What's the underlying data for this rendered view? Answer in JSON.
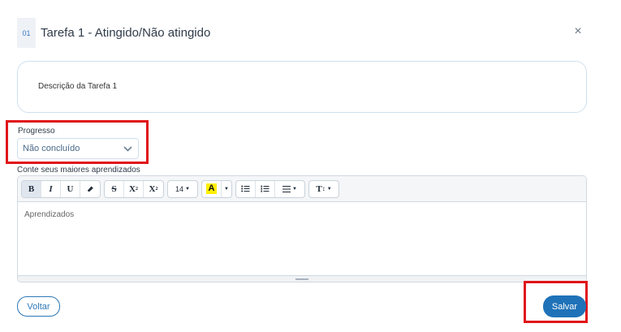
{
  "header": {
    "task_number": "01",
    "title": "Tarefa 1 - Atingido/Não atingido",
    "close_symbol": "×"
  },
  "description": {
    "text": "Descrição da Tarefa 1"
  },
  "progress": {
    "label": "Progresso",
    "selected": "Não concluído",
    "icon": "chevron-down-icon"
  },
  "learnings": {
    "label": "Conte seus maiores aprendizados",
    "placeholder": "Aprendizados",
    "toolbar": {
      "bold": "B",
      "italic": "I",
      "underline": "U",
      "eraser": "eraser-icon",
      "strike": "S",
      "superscript": "X",
      "superscript_mark": "2",
      "subscript": "X",
      "subscript_mark": "2",
      "font_size": "14",
      "highlight": "A",
      "unordered_list": "unordered-list-icon",
      "ordered_list": "ordered-list-icon",
      "align": "align-icon",
      "text_height": "T",
      "text_height_mark": "↕"
    }
  },
  "actions": {
    "back": "Voltar",
    "save": "Salvar"
  },
  "colors": {
    "primary": "#1f72b8",
    "highlight_box": "#e0141a",
    "highlight_color": "#ffef00"
  }
}
